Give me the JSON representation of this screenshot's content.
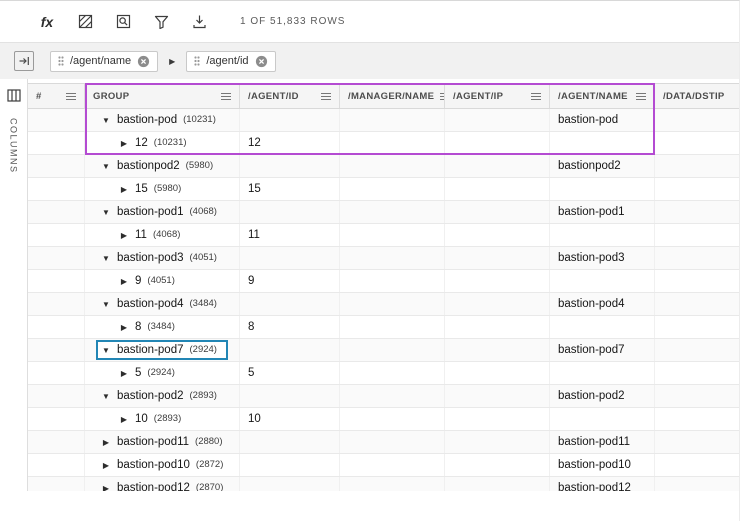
{
  "toolbar": {
    "function_label": "fx",
    "row_count": "1 OF 51,833 ROWS"
  },
  "group_bar": {
    "chips": [
      {
        "label": "/agent/name"
      },
      {
        "label": "/agent/id"
      }
    ]
  },
  "sidebar": {
    "columns_label": "COLUMNS"
  },
  "icons": {
    "chip_separator_icon": "▶",
    "group_expanded_icon": "▼",
    "group_collapsed_icon": "▶"
  },
  "table": {
    "columns": [
      {
        "label": "#"
      },
      {
        "label": "GROUP"
      },
      {
        "label": "/AGENT/ID"
      },
      {
        "label": "/MANAGER/NAME"
      },
      {
        "label": "/AGENT/IP"
      },
      {
        "label": "/AGENT/NAME"
      },
      {
        "label": "/DATA/DSTIP"
      }
    ],
    "rows": [
      {
        "level": 0,
        "expanded": true,
        "name": "bastion-pod",
        "count": "(10231)",
        "agent_name": "bastion-pod"
      },
      {
        "level": 1,
        "expanded": false,
        "name": "12",
        "count": "(10231)",
        "agent_id": "12"
      },
      {
        "level": 0,
        "expanded": true,
        "name": "bastionpod2",
        "count": "(5980)",
        "agent_name": "bastionpod2"
      },
      {
        "level": 1,
        "expanded": false,
        "name": "15",
        "count": "(5980)",
        "agent_id": "15"
      },
      {
        "level": 0,
        "expanded": true,
        "name": "bastion-pod1",
        "count": "(4068)",
        "agent_name": "bastion-pod1"
      },
      {
        "level": 1,
        "expanded": false,
        "name": "11",
        "count": "(4068)",
        "agent_id": "11"
      },
      {
        "level": 0,
        "expanded": true,
        "name": "bastion-pod3",
        "count": "(4051)",
        "agent_name": "bastion-pod3"
      },
      {
        "level": 1,
        "expanded": false,
        "name": "9",
        "count": "(4051)",
        "agent_id": "9"
      },
      {
        "level": 0,
        "expanded": true,
        "name": "bastion-pod4",
        "count": "(3484)",
        "agent_name": "bastion-pod4"
      },
      {
        "level": 1,
        "expanded": false,
        "name": "8",
        "count": "(3484)",
        "agent_id": "8"
      },
      {
        "level": 0,
        "expanded": true,
        "name": "bastion-pod7",
        "count": "(2924)",
        "agent_name": "bastion-pod7",
        "highlighted": true
      },
      {
        "level": 1,
        "expanded": false,
        "name": "5",
        "count": "(2924)",
        "agent_id": "5"
      },
      {
        "level": 0,
        "expanded": true,
        "name": "bastion-pod2",
        "count": "(2893)",
        "agent_name": "bastion-pod2"
      },
      {
        "level": 1,
        "expanded": false,
        "name": "10",
        "count": "(2893)",
        "agent_id": "10"
      },
      {
        "level": 0,
        "expanded": false,
        "name": "bastion-pod11",
        "count": "(2880)",
        "agent_name": "bastion-pod11"
      },
      {
        "level": 0,
        "expanded": false,
        "name": "bastion-pod10",
        "count": "(2872)",
        "agent_name": "bastion-pod10"
      },
      {
        "level": 0,
        "expanded": false,
        "name": "bastion-pod12",
        "count": "(2870)",
        "agent_name": "bastion-pod12"
      }
    ]
  },
  "annotations": {
    "purple_box_color": "#b44bd2",
    "blue_box_color": "#2286b5"
  }
}
